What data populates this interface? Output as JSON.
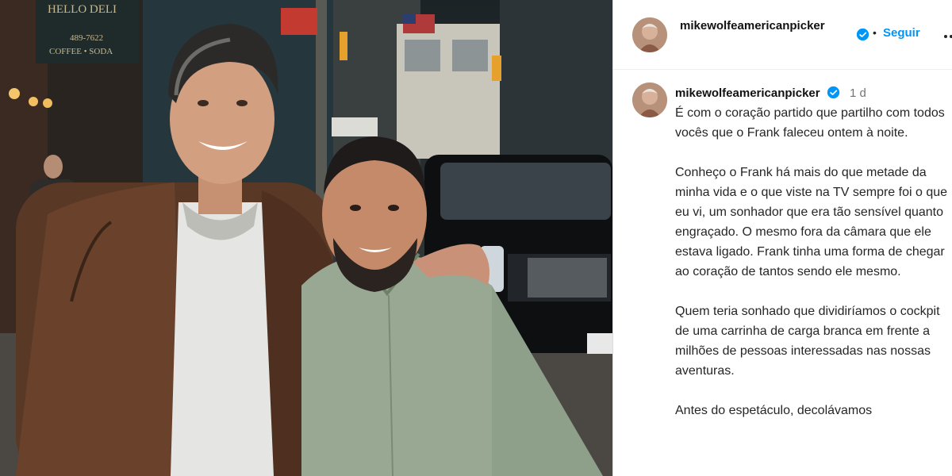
{
  "post": {
    "username": "mikewolfeamericanpicker",
    "follow_label": "Seguir",
    "separator": "•",
    "verified_icon": "verified-badge-icon",
    "more_icon": "more-options-icon"
  },
  "comment": {
    "username": "mikewolfeamericanpicker",
    "time": "1 d",
    "paragraphs": [
      "É com o coração partido que partilho com todos vocês que o Frank faleceu ontem à noite.",
      "Conheço o Frank há mais do que metade da minha vida e o que viste na TV sempre foi o que eu vi, um sonhador que era tão sensível quanto engraçado. O mesmo fora da câmara que ele estava ligado. Frank tinha uma forma de chegar ao coração de tantos sendo ele mesmo.",
      "Quem teria sonhado que dividiríamos o cockpit de uma carrinha de carga branca em frente a milhões de pessoas interessadas nas nossas aventuras.",
      "Antes do espetáculo, decolávamos"
    ]
  },
  "photo": {
    "sign_top": "HELLO DELI",
    "sign_phone": "489-7622",
    "sign_bottom": "COFFEE • SODA"
  },
  "colors": {
    "accent": "#0095f6",
    "muted": "#737373"
  }
}
